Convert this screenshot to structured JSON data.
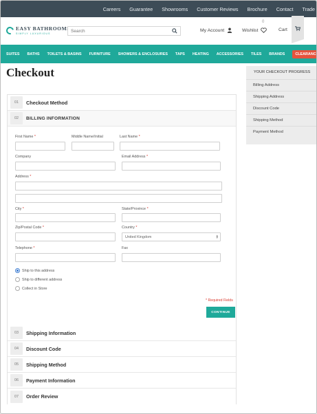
{
  "topbar": {
    "links": [
      "Careers",
      "Guarantee",
      "Showrooms",
      "Customer Reviews",
      "Brochure",
      "Contact",
      "Trade"
    ]
  },
  "header": {
    "logo_name": "EASY BATHROOMS",
    "logo_tagline": "SIMPLY LUXURIOUS",
    "search_placeholder": "Search",
    "account_label": "My Account",
    "wishlist_label": "Wishlist",
    "wishlist_count": "0",
    "cart_label": "Cart"
  },
  "nav": {
    "items": [
      "SUITES",
      "BATHS",
      "TOILETS & BASINS",
      "FURNITURE",
      "SHOWERS & ENCLOSURES",
      "TAPS",
      "HEATING",
      "ACCESSORIES",
      "TILES",
      "BRANDS"
    ],
    "highlight": "CLEARANCE"
  },
  "page": {
    "title": "Checkout"
  },
  "progress": {
    "heading": "YOUR CHECKOUT PROGRESS",
    "items": [
      "Billing Address",
      "Shipping Address",
      "Discount Code",
      "Shipping Method",
      "Payment Method"
    ]
  },
  "steps": [
    {
      "num": "01",
      "title": "Checkout Method"
    },
    {
      "num": "02",
      "title": "Billing Information"
    },
    {
      "num": "03",
      "title": "Shipping Information"
    },
    {
      "num": "04",
      "title": "Discount Code"
    },
    {
      "num": "05",
      "title": "Shipping Method"
    },
    {
      "num": "06",
      "title": "Payment Information"
    },
    {
      "num": "07",
      "title": "Order Review"
    }
  ],
  "form": {
    "first_name": "First Name",
    "middle_name": "Middle Name/Initial",
    "last_name": "Last Name",
    "company": "Company",
    "email": "Email Address",
    "address": "Address",
    "city": "City",
    "state": "State/Province",
    "zip": "Zip/Postal Code",
    "country": "Country",
    "country_value": "United Kingdom",
    "telephone": "Telephone",
    "fax": "Fax",
    "required_star": "*",
    "ship_options": [
      "Ship to this address",
      "Ship to different address",
      "Collect in Store"
    ],
    "required_note": "* Required Fields",
    "continue_label": "CONTINUE"
  },
  "colors": {
    "accent": "#1fa99a",
    "topbar": "#3d4c57",
    "clearance": "#e5533d",
    "required": "#d9362b"
  }
}
